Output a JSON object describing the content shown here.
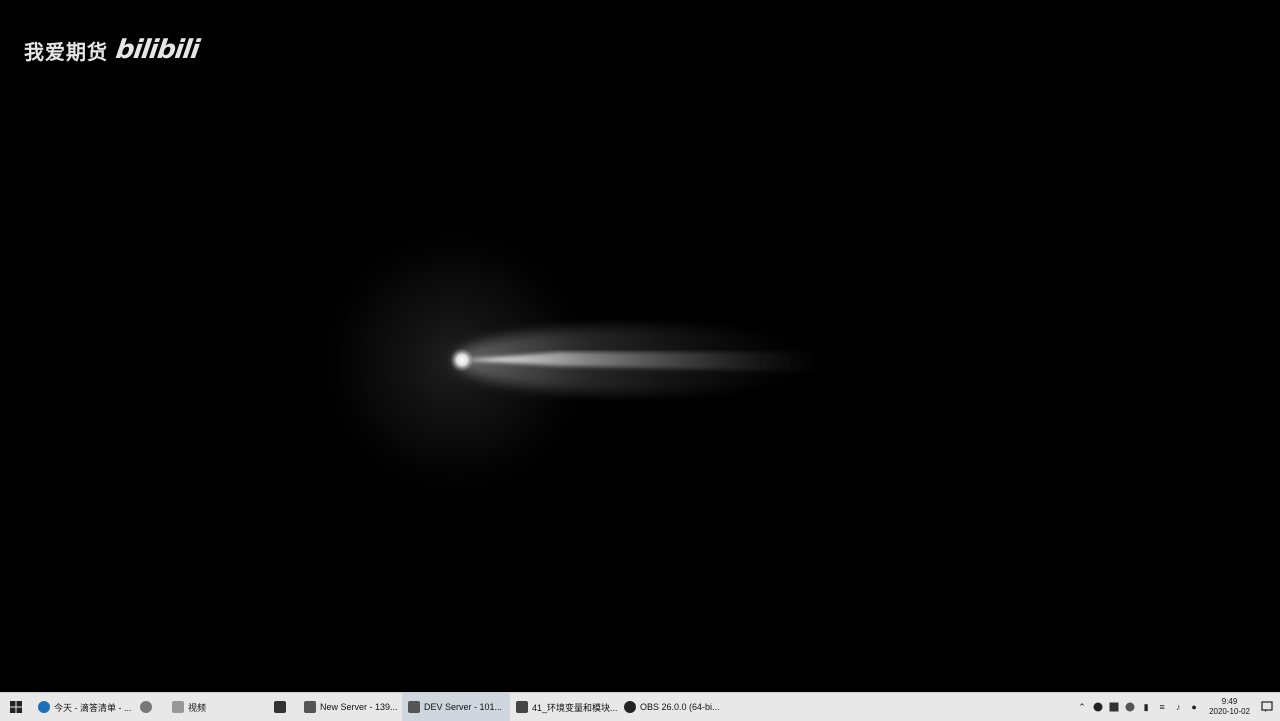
{
  "watermark": {
    "channel": "我爱期货",
    "brand": "bilibili"
  },
  "taskbar": {
    "items": [
      {
        "label": "今天 - 滴答清单 - ..."
      },
      {
        "label": ""
      },
      {
        "label": "视频"
      },
      {
        "label": ""
      },
      {
        "label": "New Server - 139..."
      },
      {
        "label": "DEV Server - 101..."
      },
      {
        "label": "41_环境变量和模块..."
      },
      {
        "label": "OBS 26.0.0 (64-bi..."
      }
    ],
    "clock": {
      "time": "9:49",
      "date": "2020-10-02"
    }
  }
}
